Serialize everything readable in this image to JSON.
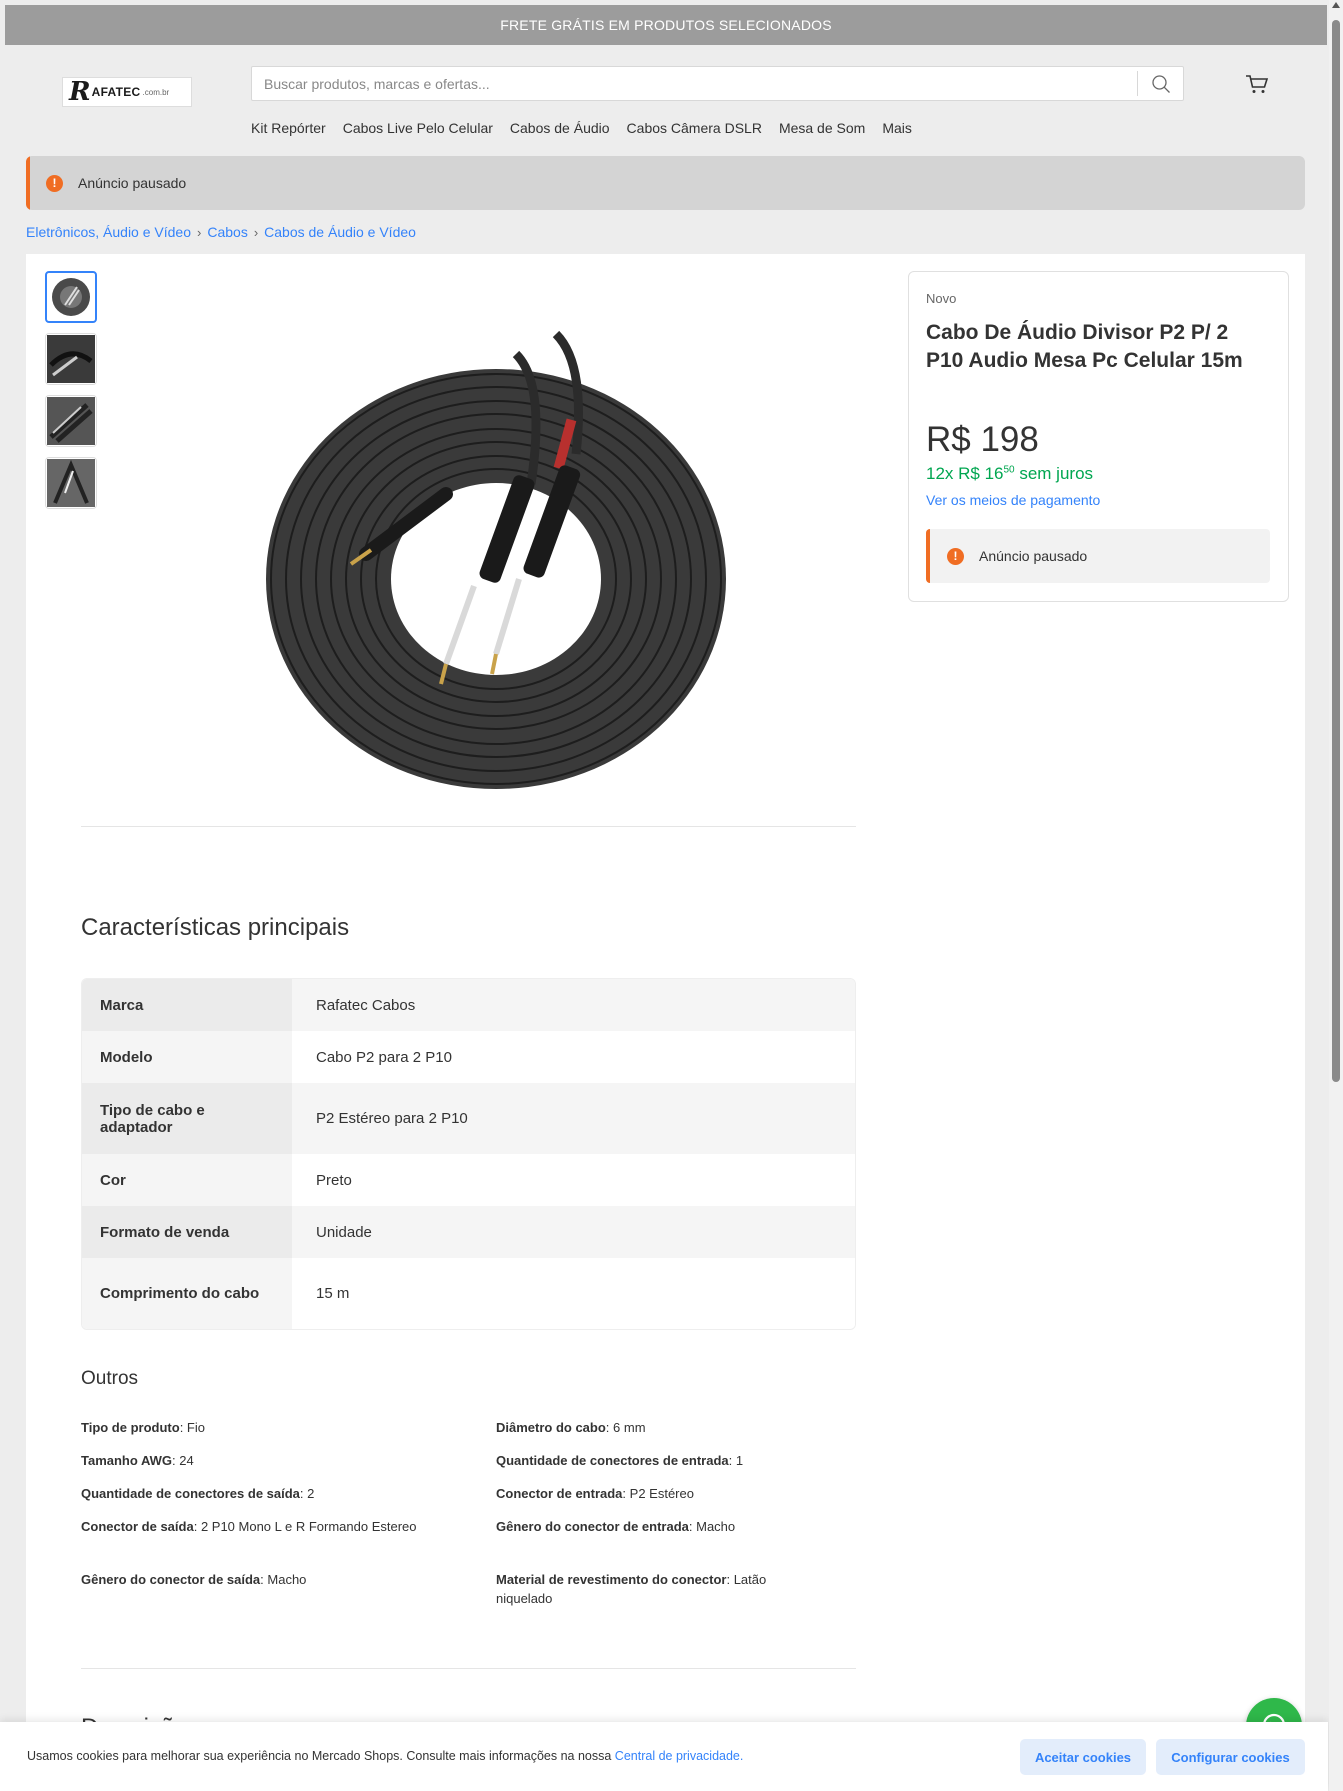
{
  "topbar": {
    "text": "FRETE GRÁTIS EM PRODUTOS SELECIONADOS"
  },
  "logo": {
    "letter": "R",
    "text": "AFATEC",
    "suffix": ".com.br"
  },
  "search": {
    "placeholder": "Buscar produtos, marcas e ofertas...",
    "icon": "search-icon"
  },
  "header": {
    "cart_icon": "cart-icon"
  },
  "nav": {
    "items": [
      "Kit Repórter",
      "Cabos Live Pelo Celular",
      "Cabos de Áudio",
      "Cabos Câmera DSLR",
      "Mesa de Som",
      "Mais"
    ]
  },
  "alert": {
    "text": "Anúncio pausado",
    "badge": "!",
    "color": "#f06d23"
  },
  "breadcrumb": {
    "items": [
      "Eletrônicos, Áudio e Vídeo",
      "Cabos",
      "Cabos de Áudio e Vídeo"
    ],
    "separator": "›"
  },
  "product": {
    "condition": "Novo",
    "title": "Cabo De Áudio Divisor P2 P/ 2 P10 Audio Mesa Pc Celular 15m",
    "price": "R$ 198",
    "installments_prefix": "12x R$ 16",
    "installments_cents": "50",
    "installments_suffix": " sem juros",
    "payment_link": "Ver os meios de pagamento",
    "paused_text": "Anúncio pausado"
  },
  "specs": {
    "title": "Características principais",
    "rows": [
      {
        "k": "Marca",
        "v": "Rafatec Cabos"
      },
      {
        "k": "Modelo",
        "v": "Cabo P2 para 2 P10"
      },
      {
        "k": "Tipo de cabo e adaptador",
        "v": "P2 Estéreo para 2 P10"
      },
      {
        "k": "Cor",
        "v": "Preto"
      },
      {
        "k": "Formato de venda",
        "v": "Unidade"
      },
      {
        "k": "Comprimento do cabo",
        "v": "15 m"
      }
    ]
  },
  "others": {
    "title": "Outros",
    "items": [
      {
        "k": "Tipo de produto",
        "v": "Fio"
      },
      {
        "k": "Diâmetro do cabo",
        "v": "6 mm"
      },
      {
        "k": "Tamanho AWG",
        "v": "24"
      },
      {
        "k": "Quantidade de conectores de entrada",
        "v": "1"
      },
      {
        "k": "Quantidade de conectores de saída",
        "v": "2"
      },
      {
        "k": "Conector de entrada",
        "v": "P2 Estéreo"
      },
      {
        "k": "Conector de saída",
        "v": "2 P10 Mono L e R Formando Estereo"
      },
      {
        "k": "Gênero do conector de entrada",
        "v": "Macho"
      },
      {
        "k": "Gênero do conector de saída",
        "v": "Macho"
      },
      {
        "k": "Material de revestimento do conector",
        "v": "Latão niquelado"
      }
    ]
  },
  "description": {
    "title": "Descrição"
  },
  "cookie": {
    "text": "Usamos cookies para melhorar sua experiência no Mercado Shops. Consulte mais informações na nossa ",
    "link": "Central de privacidade.",
    "accept": "Aceitar cookies",
    "configure": "Configurar cookies"
  },
  "colors": {
    "accent": "#3483fa",
    "green": "#00a650",
    "warning": "#f06d23",
    "whatsapp": "#2fb84a"
  }
}
